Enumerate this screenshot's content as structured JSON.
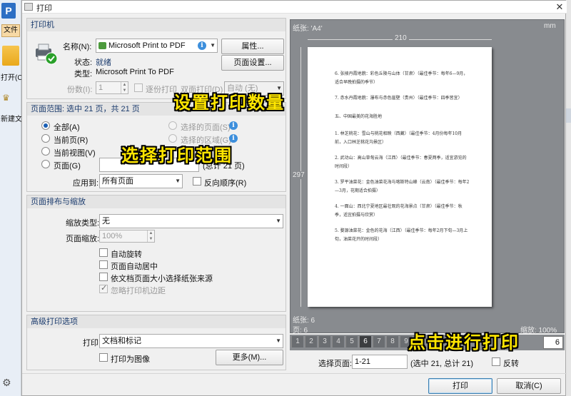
{
  "background_app": {
    "logo": "P",
    "file_menu": "文件",
    "open_label": "打开(C",
    "new_label": "新建文"
  },
  "dialog": {
    "title": "打印",
    "close": "✕"
  },
  "printer": {
    "header": "打印机",
    "name_label": "名称(N):",
    "name_value": "Microsoft Print to PDF",
    "properties_button": "属性...",
    "status_label": "状态:",
    "status_value": "就绪",
    "type_label": "类型:",
    "type_value": "Microsoft Print To PDF",
    "page_setup_button": "页面设置...",
    "copies_label": "份数(I):",
    "copies_value": "1",
    "collate_label": "逐份打印",
    "duplex_label": "双面打印(D)",
    "duplex_value": "自动 (无)"
  },
  "range": {
    "header": "页面范围: 选中 21 页，共 21 页",
    "options": {
      "all": "全部(A)",
      "current_page": "当前页(R)",
      "current_view": "当前视图(V)",
      "pages": "页面(G)",
      "selected_pages": "选择的页面(S)",
      "selected_area": "选择的区域(G)"
    },
    "pages_total": "(总计 21 页)",
    "apply_label": "应用到:",
    "apply_value": "所有页面",
    "reverse_label": "反向顺序(R)"
  },
  "layout": {
    "header": "页面排布与缩放",
    "scale_type_label": "缩放类型:",
    "scale_type_value": "无",
    "page_scale_label": "页面缩放:",
    "page_scale_value": "100%",
    "auto_rotate": "自动旋转",
    "auto_center": "页面自动居中",
    "choose_source": "依文档页面大小选择纸张来源",
    "ignore_margins": "忽略打印机边距"
  },
  "advanced": {
    "header": "高级打印选项",
    "print_label": "打印",
    "print_value": "文档和标记",
    "as_image": "打印为图像",
    "more_button": "更多(M)..."
  },
  "preview": {
    "paper_label": "纸张: 'A4'",
    "unit": "mm",
    "width": "210",
    "height": "297",
    "sheets_label": "纸张: 6",
    "pages_label": "页: 6",
    "zoom_label": "缩放: 100%",
    "page_numbers": [
      "1",
      "2",
      "3",
      "4",
      "5",
      "6",
      "7",
      "8",
      "9"
    ],
    "current_page": "6",
    "total_pages_visible": "6",
    "content_lines": [
      "6. 张掖丹霞地貌：彩色丘陵与山体（甘肃）（最佳季节：每年6—9月，适合早晚拍摄的季节）",
      "7. 赤水丹霞地貌：瀑布与赤色崖壁（贵州）（最佳季节：四季皆宜）",
      "五、中国最美的花海胜地",
      "1. 林芝桃花：雪山与桃花相映（西藏）（最佳季节：4月份每年10月前，入口林芝桃花沟景区）",
      "2. 武功山：高山草甸云海（江西）（最佳季节：春夏两季，适宜游览的时间段）",
      "3. 罗平油菜花：金色油菜花海与喀斯特山峰（云南）（最佳季节：每年2—3月，花期适合拍摄）",
      "4. 一面山：西北宁夏地区最壮观的花海景点（甘肃）（最佳季节：秋季，适宜拍摄与欣赏）",
      "5. 婺源油菜花：金色的花海（江西）（最佳季节：每年2月下旬—3月上旬，油菜花开的时间段）"
    ]
  },
  "bottom": {
    "select_label": "选择页面:",
    "select_value": "1-21",
    "select_info": "(选中 21, 总计 21)",
    "reverse_label": "反转",
    "print_button": "打印",
    "cancel_button": "取消(C)"
  },
  "annotations": {
    "set_copies": "设置打印数量",
    "select_range": "选择打印范围",
    "click_print": "点击进行打印"
  },
  "colors": {
    "accent": "#1a5fb4",
    "overlay_text": "#ffe600",
    "preview_bg": "#888b8f"
  }
}
